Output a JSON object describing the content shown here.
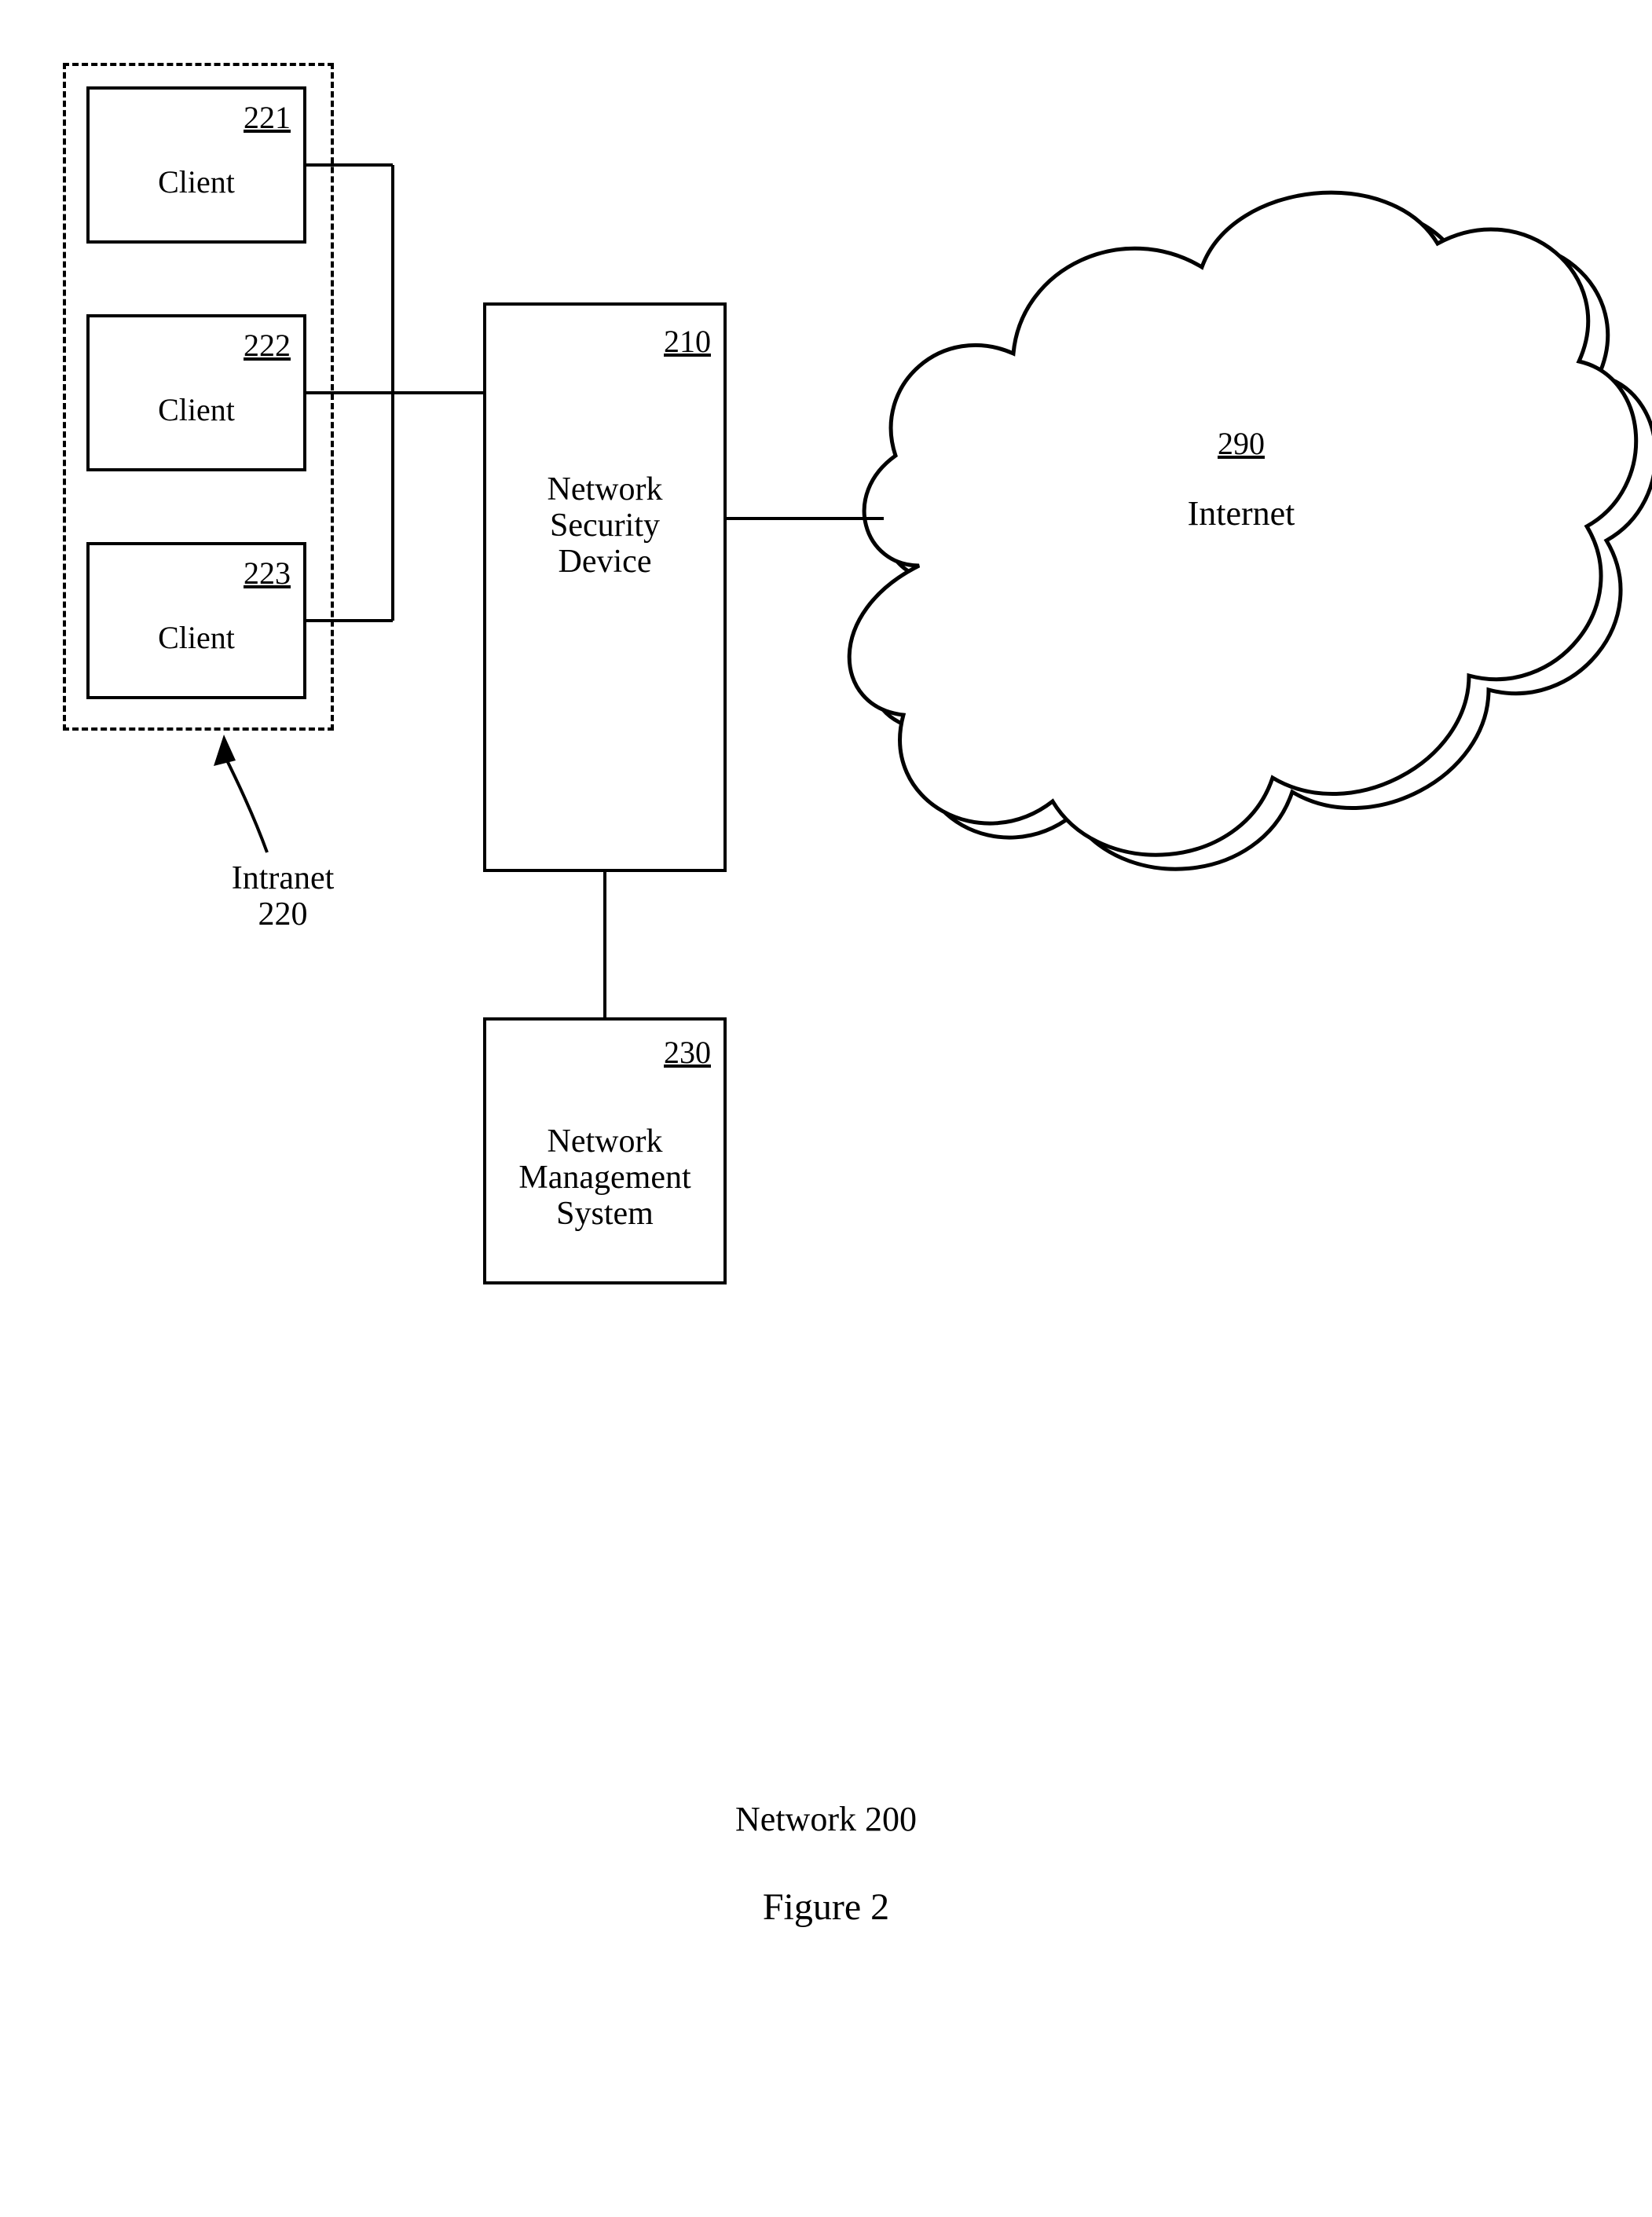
{
  "figure": {
    "title": "Figure 2",
    "caption": "Network 200"
  },
  "intranet": {
    "label": "Intranet\n220"
  },
  "clients": [
    {
      "num": "221",
      "label": "Client"
    },
    {
      "num": "222",
      "label": "Client"
    },
    {
      "num": "223",
      "label": "Client"
    }
  ],
  "nsd": {
    "num": "210",
    "label": "Network\nSecurity\nDevice"
  },
  "nms": {
    "num": "230",
    "label": "Network\nManagement\nSystem"
  },
  "internet": {
    "num": "290",
    "label": "Internet"
  }
}
